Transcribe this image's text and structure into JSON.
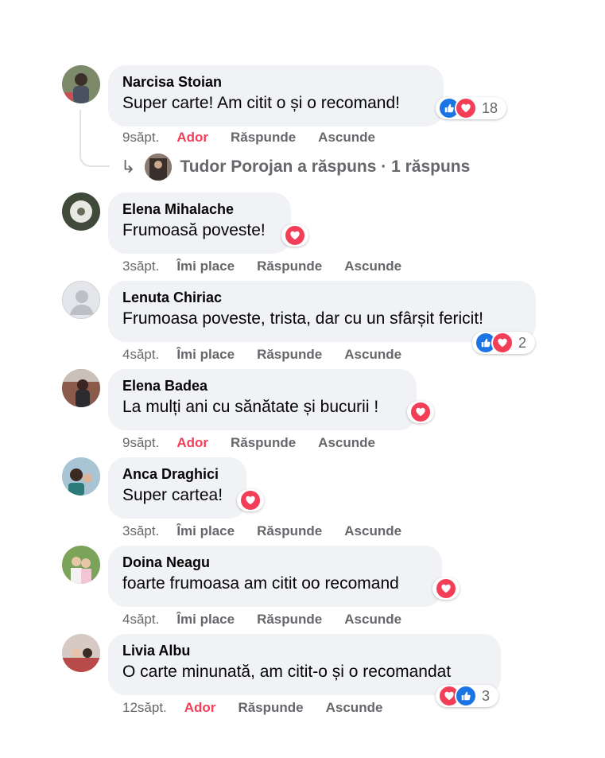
{
  "comments": [
    {
      "author": "Narcisa Stoian",
      "text": "Super carte! Am citit o și o recomand!",
      "time": "9săpt.",
      "like_label": "Ador",
      "reply_label": "Răspunde",
      "hide_label": "Ascunde",
      "reactions": [
        "like",
        "love"
      ],
      "reaction_count": "18",
      "replies_summary": "Tudor Porojan a răspuns · 1 răspuns"
    },
    {
      "author": "Elena Mihalache",
      "text": "Frumoasă poveste!",
      "time": "3săpt.",
      "like_label": "Îmi place",
      "reply_label": "Răspunde",
      "hide_label": "Ascunde",
      "reactions": [
        "love"
      ]
    },
    {
      "author": "Lenuta Chiriac",
      "text": "Frumoasa poveste, trista, dar cu un sfârșit fericit!",
      "time": "4săpt.",
      "like_label": "Îmi place",
      "reply_label": "Răspunde",
      "hide_label": "Ascunde",
      "reactions": [
        "like",
        "love"
      ],
      "reaction_count": "2"
    },
    {
      "author": "Elena Badea",
      "text": "La mulți ani cu sănătate și bucurii !",
      "time": "9săpt.",
      "like_label": "Ador",
      "reply_label": "Răspunde",
      "hide_label": "Ascunde",
      "reactions": [
        "love"
      ]
    },
    {
      "author": "Anca Draghici",
      "text": "Super cartea!",
      "time": "3săpt.",
      "like_label": "Îmi place",
      "reply_label": "Răspunde",
      "hide_label": "Ascunde",
      "reactions": [
        "love"
      ]
    },
    {
      "author": "Doina Neagu",
      "text": "foarte frumoasa am citit oo recomand",
      "time": "4săpt.",
      "like_label": "Îmi place",
      "reply_label": "Răspunde",
      "hide_label": "Ascunde",
      "reactions": [
        "love"
      ]
    },
    {
      "author": "Livia Albu",
      "text": "O carte minunată, am citit-o și o recomandat",
      "time": "12săpt.",
      "like_label": "Ador",
      "reply_label": "Răspunde",
      "hide_label": "Ascunde",
      "reactions": [
        "love",
        "like"
      ],
      "reaction_count": "3"
    }
  ],
  "colors": {
    "bubble": "#f0f2f5",
    "meta_text": "#65676b",
    "love_red": "#f33e58",
    "like_blue": "#1b74e4"
  },
  "icons": {
    "like": "thumbs-up-icon",
    "love": "heart-icon",
    "reply_arrow": "reply-arrow-icon"
  }
}
